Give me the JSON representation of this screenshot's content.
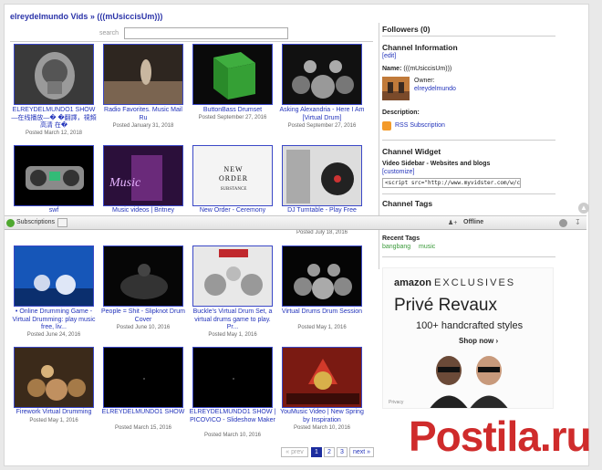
{
  "header": {
    "title": "elreydelmundo Vids » (((mUsiccisUm)))"
  },
  "search": {
    "label": "search"
  },
  "videos": [
    {
      "title": "ELREYDELMUNDO1 SHOW—在线播放—� �翻譯，視頻高清 在�",
      "date": "Posted March 12, 2018"
    },
    {
      "title": "Radio Favorites. Music Mail Ru",
      "date": "Posted January 31, 2018"
    },
    {
      "title": "ButtonBass Drumset",
      "date": "Posted September 27, 2016"
    },
    {
      "title": "Asking Alexandria - Here I Am [Virtual Drum]",
      "date": "Posted September 27, 2016"
    },
    {
      "title": "swf",
      "date": ""
    },
    {
      "title": "Music videos | Britney",
      "date": ""
    },
    {
      "title": "New Order - Ceremony",
      "date": ""
    },
    {
      "title": "DJ Turntable - Play Free",
      "date": "Posted July 18, 2016"
    },
    {
      "title": "• Online Drumming Game - Virtual Drumming: play music free, liv...",
      "date": "Posted June 24, 2016"
    },
    {
      "title": "People = Shit - Slipknot Drum Cover",
      "date": "Posted June 10, 2016"
    },
    {
      "title": "Buckle's Virtual Drum Set, a virtual drums game to play. Pr...",
      "date": "Posted May 1, 2016"
    },
    {
      "title": "Virtual Drums Drum Session",
      "date": "Posted May 1, 2016"
    },
    {
      "title": "Firework Virtual Drumming",
      "date": "Posted May 1, 2016"
    },
    {
      "title": "ELREYDELMUNDO1 SHOW",
      "date": "Posted March 15, 2016"
    },
    {
      "title": "ELREYDELMUNDO1 SHOW | PICOVICO - Slideshow Maker",
      "date": "Posted March 10, 2016"
    },
    {
      "title": "YouMusic Video | New Spring by Inspiration",
      "date": "Posted March 10, 2016"
    }
  ],
  "pagination": {
    "prev": "« prev",
    "p1": "1",
    "p2": "2",
    "p3": "3",
    "next": "next »"
  },
  "sidebar": {
    "followers": "Followers (0)",
    "channel_info_heading": "Channel Information",
    "edit": "[edit]",
    "name_label": "Name:",
    "name_value": "(((mUsiccisUm)))",
    "owner_label": "Owner:",
    "owner_value": "elreydelmundo",
    "description_label": "Description:",
    "rss": "RSS Subscription",
    "widget_heading": "Channel Widget",
    "widget_label": "Video Sidebar - Websites and blogs",
    "customize": "[customize]",
    "embed_code": "<script src=\"http://www.myvidster.com/w/c1227061\" t",
    "tags_heading": "Channel Tags",
    "recent_tags_label": "Recent Tags",
    "tags": [
      "bangbang",
      "music"
    ]
  },
  "toolbar": {
    "subscriptions": "Subscriptions",
    "status": "Offline"
  },
  "ad": {
    "brand": "amazon",
    "brand_suffix": "EXCLUSIVES",
    "product": "Privé Revaux",
    "tagline": "100+ handcrafted styles",
    "cta": "Shop now ›",
    "privacy": "Privacy"
  },
  "watermark": "Postila.ru",
  "colors": {
    "link": "#2233bb",
    "tag": "#3a9a3a",
    "watermark": "#cf2b2b"
  }
}
